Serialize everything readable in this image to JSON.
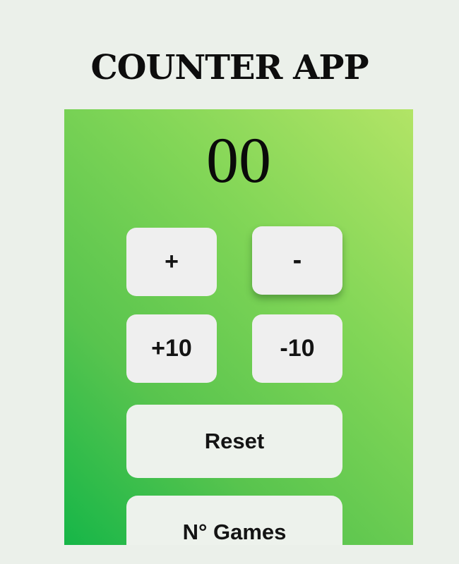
{
  "app": {
    "title": "COUNTER APP"
  },
  "counter": {
    "value": "00"
  },
  "buttons": {
    "increment": "+",
    "decrement": "-",
    "increment_ten": "+10",
    "decrement_ten": "-10",
    "reset": "Reset",
    "games": "N° Games"
  },
  "colors": {
    "page_background": "#ebf0ea",
    "panel_gradient_light": "#b2e466",
    "panel_gradient_dark": "#16b648",
    "button_background": "#efefef"
  }
}
